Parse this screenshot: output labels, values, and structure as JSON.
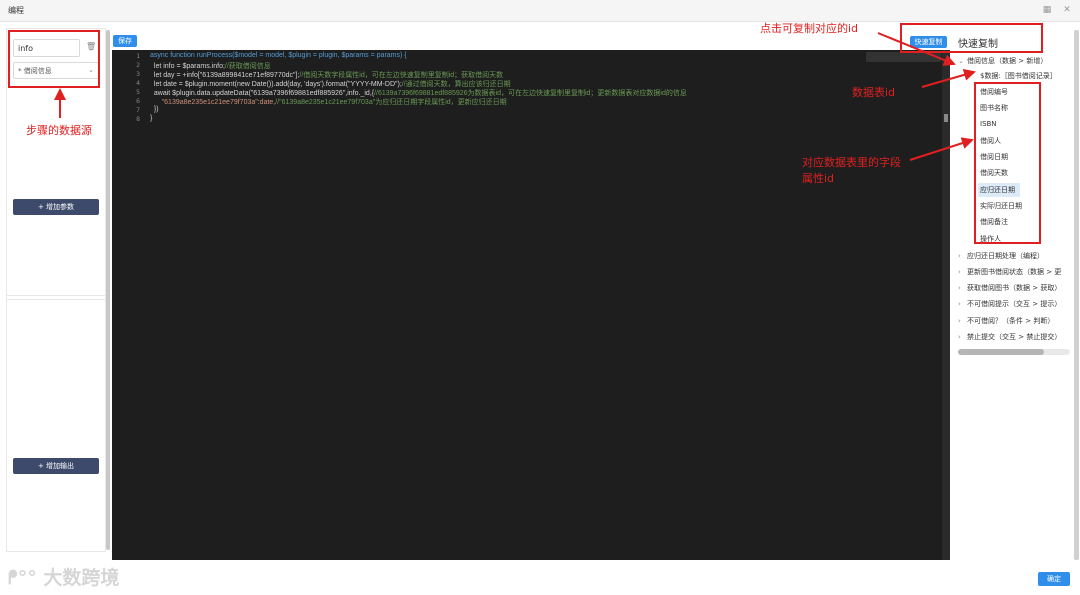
{
  "window": {
    "title": "编程"
  },
  "left": {
    "param_value": "info",
    "select_value": "* 借阅信息",
    "add_param": "+ 增加参数",
    "add_output": "+ 增加输出"
  },
  "toolbar": {
    "save": "保存",
    "quick_copy_btn": "快速复制",
    "quick_copy_label": "快速复制"
  },
  "code": {
    "line_numbers": [
      "1",
      "2",
      "3",
      "4",
      "5",
      "6",
      "7",
      "8"
    ],
    "l1": "async function runProcess($model = model, $plugin = plugin, $params = params) {",
    "l2a": "  let info = $params.info;",
    "l2b": "//获取借阅信息",
    "l3a": "  let day = +info[\"6139a899841ce71ef89770dc\"];",
    "l3b": "//借阅天数字段属性id，可在左边快速复制里复制id；获取借阅天数",
    "l4a": "  let date = $plugin.moment(new Date()).add(day, 'days').format(\"YYYY-MM-DD\");",
    "l4b": "//通过借阅天数，算出应该归还日期",
    "l5a": "  await $plugin.data.updateData(\"6139a7396f69881edf885926\",info._id,{",
    "l5b": "//6139a7396f69881edf885926为数据表id，可在左边快速复制里复制id；更新数据表对应数据id的信息",
    "l6a": "      \"6139a8e235e1c21ee79f703a\":date,",
    "l6b": "//\"6139a8e235e1c21ee79f703a\"为应归还日期字段属性id，更新应归还日期",
    "l7": "  })",
    "l8": "}"
  },
  "tree": {
    "root": "借阅信息（数据 > 新增）",
    "table": "$数据:［图书借阅记录］",
    "fields": [
      "借阅编号",
      "图书名称",
      "ISBN",
      "借阅人",
      "借阅日期",
      "借阅天数",
      "应归还日期",
      "实际归还日期",
      "借阅备注",
      "操作人"
    ],
    "selected_field": "应归还日期",
    "nodes": [
      "应归还日期处理（编程）",
      "更新图书借阅状态（数据 > 更",
      "获取借阅图书（数据 > 获取）",
      "不可借阅提示（交互 > 提示）",
      "不可借阅？（条件 > 判断）",
      "禁止提交（交互 > 禁止提交）"
    ]
  },
  "annotations": {
    "click_copy": "点击可复制对应的id",
    "table_id": "数据表id",
    "field_id_1": "对应数据表里的字段",
    "field_id_2": "属性id",
    "data_source": "步骤的数据源"
  },
  "footer": {
    "ok": "确定",
    "watermark": "大数跨境"
  },
  "colors": {
    "accent": "#2f8ee9",
    "annotation": "#e02020",
    "editor_bg": "#1e1e1e"
  }
}
